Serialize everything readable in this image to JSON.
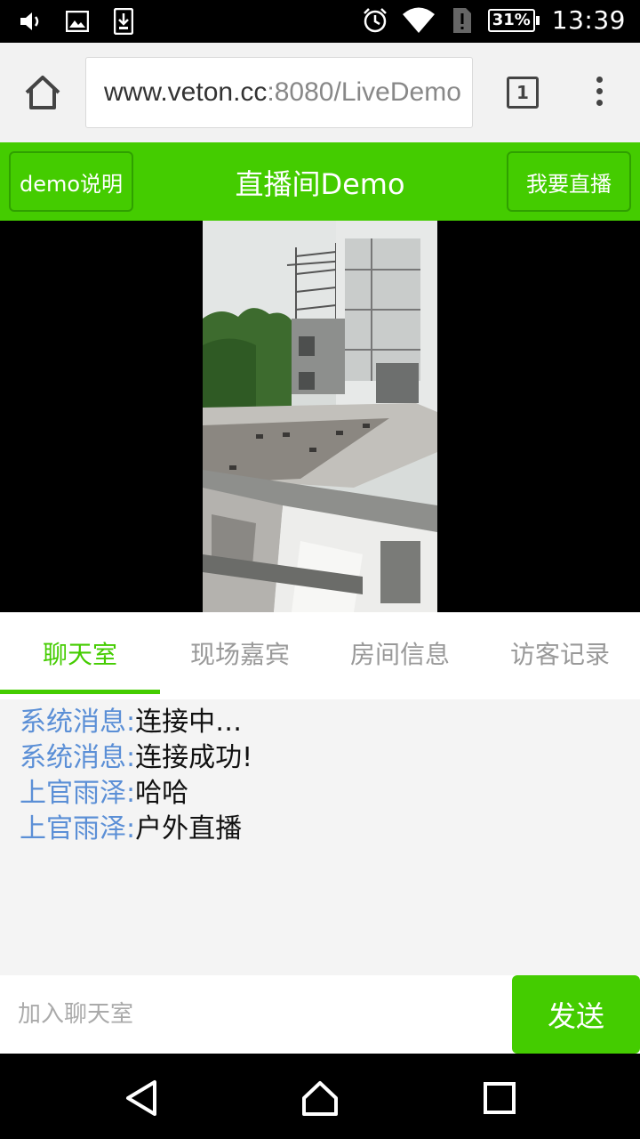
{
  "status_bar": {
    "icons_left": [
      "volume-icon",
      "image-icon",
      "download-icon"
    ],
    "icons_right": [
      "alarm-icon",
      "wifi-icon",
      "sim-alert-icon"
    ],
    "battery": "31%",
    "time": "13:39"
  },
  "browser": {
    "url_main": "www.veton.cc",
    "url_rest": ":8080/LiveDemo",
    "tab_count": "1"
  },
  "header": {
    "left_button": "demo说明",
    "title": "直播间Demo",
    "right_button": "我要直播"
  },
  "tabs": [
    {
      "label": "聊天室",
      "active": true
    },
    {
      "label": "现场嘉宾",
      "active": false
    },
    {
      "label": "房间信息",
      "active": false
    },
    {
      "label": "访客记录",
      "active": false
    }
  ],
  "chat": {
    "messages": [
      {
        "name": "系统消息:",
        "text": "连接中…"
      },
      {
        "name": "系统消息:",
        "text": "连接成功!"
      },
      {
        "name": "上官雨泽:",
        "text": "哈哈"
      },
      {
        "name": "上官雨泽:",
        "text": "户外直播"
      }
    ]
  },
  "input": {
    "placeholder": "加入聊天室",
    "value": "",
    "send_label": "发送"
  },
  "colors": {
    "accent": "#44cc00",
    "name_blue": "#5b8fd6"
  }
}
